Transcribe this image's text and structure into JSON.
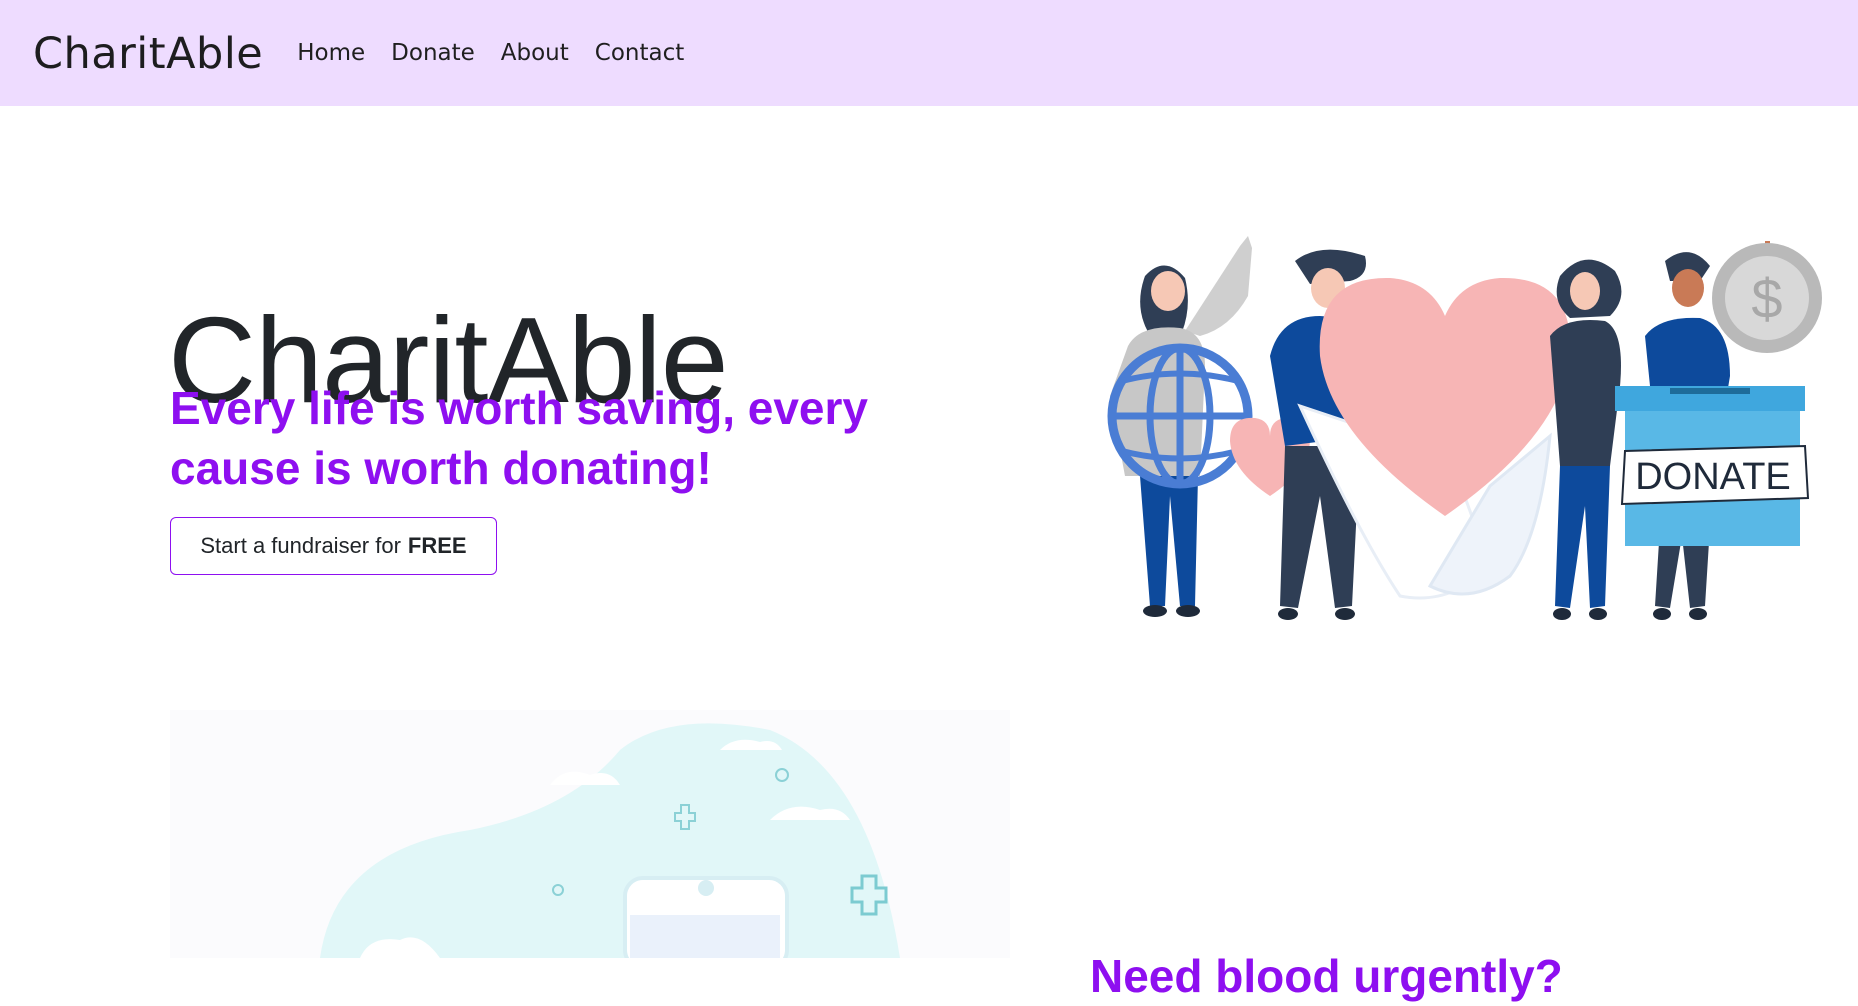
{
  "nav": {
    "brand": "CharitAble",
    "links": [
      "Home",
      "Donate",
      "About",
      "Contact"
    ]
  },
  "hero": {
    "title_light": "Charit",
    "title_bold": "Able",
    "tagline": "Every life is worth saving, every cause is worth donating!",
    "cta_prefix": "Start a fundraiser for",
    "cta_emphasis": "FREE",
    "illustration_sign": "DONATE",
    "illustration_coin": "$"
  },
  "section2": {
    "heading": "Need blood urgently?"
  },
  "colors": {
    "navbar_bg": "#eedcff",
    "accent": "#8e0ff0",
    "text": "#212529"
  },
  "icons": [
    "globe-icon",
    "heart-icon",
    "donation-box-icon",
    "coin-icon",
    "medical-cross-icon"
  ]
}
